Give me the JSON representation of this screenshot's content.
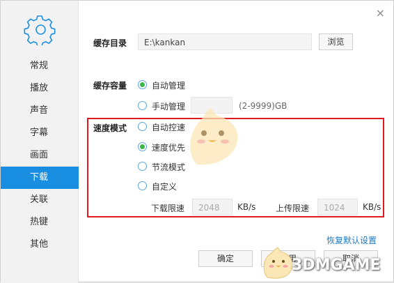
{
  "sidebar": {
    "items": [
      {
        "label": "常规",
        "active": false
      },
      {
        "label": "播放",
        "active": false
      },
      {
        "label": "声音",
        "active": false
      },
      {
        "label": "字幕",
        "active": false
      },
      {
        "label": "画面",
        "active": false
      },
      {
        "label": "下载",
        "active": true
      },
      {
        "label": "关联",
        "active": false
      },
      {
        "label": "热键",
        "active": false
      },
      {
        "label": "其他",
        "active": false
      }
    ]
  },
  "window": {
    "close_label": "×"
  },
  "cache_dir": {
    "label": "缓存目录",
    "value": "E:\\kankan",
    "browse_label": "浏览"
  },
  "cache_capacity": {
    "label": "缓存容量",
    "auto_label": "自动管理",
    "manual_label": "手动管理",
    "manual_value": "",
    "range_label": "(2-9999)GB",
    "selected": "auto"
  },
  "speed_mode": {
    "label": "速度模式",
    "options": [
      {
        "label": "自动控速",
        "checked": false
      },
      {
        "label": "速度优先",
        "checked": true
      },
      {
        "label": "节流模式",
        "checked": false
      },
      {
        "label": "自定义",
        "checked": false
      }
    ],
    "download_limit_label": "下载限速",
    "download_limit_value": "2048",
    "download_unit": "KB/s",
    "upload_limit_label": "上传限速",
    "upload_limit_value": "1024",
    "upload_unit": "KB/s"
  },
  "footer": {
    "restore_label": "恢复默认设置",
    "ok_label": "确定",
    "apply_label": "应用",
    "cancel_label": "取消"
  },
  "watermark": {
    "text": "3DMGAME"
  },
  "colors": {
    "accent": "#1a8ee0",
    "highlight_box": "#e0191f",
    "radio_checked": "#3ab54a",
    "link": "#1a78c2"
  }
}
